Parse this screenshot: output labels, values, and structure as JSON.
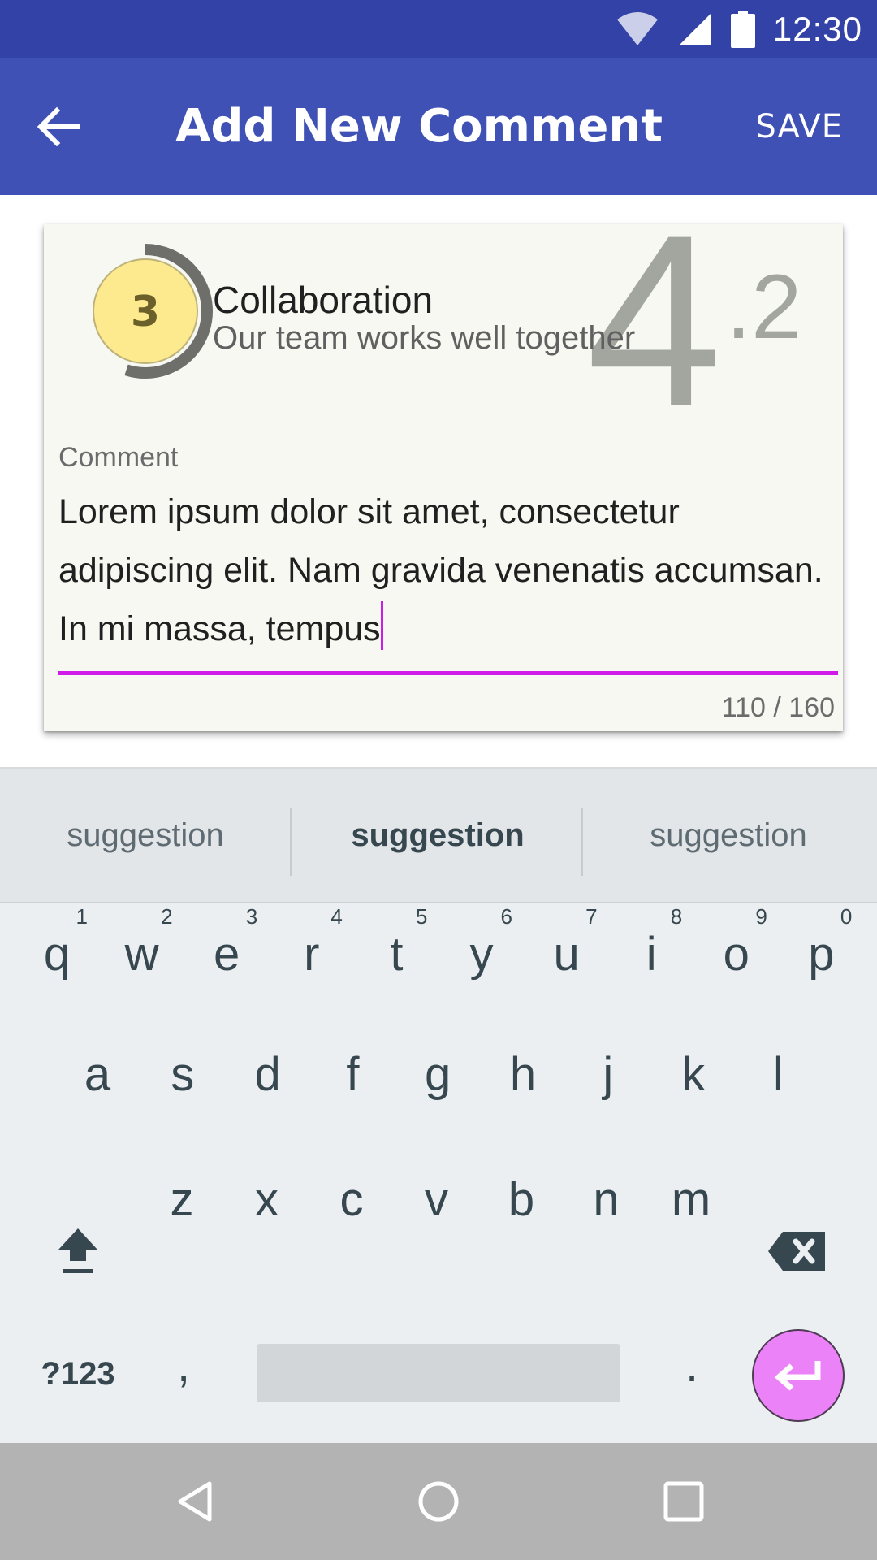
{
  "status_bar": {
    "time": "12:30",
    "icons": [
      "wifi-icon",
      "signal-icon",
      "battery-icon"
    ]
  },
  "app_bar": {
    "title": "Add New Comment",
    "save_label": "SAVE",
    "back_icon": "arrow-left-icon",
    "color": "#3f51b5"
  },
  "card": {
    "rank": "3",
    "ring_progress": 0.55,
    "topic_title": "Collaboration",
    "topic_subtitle": "Our team works well together",
    "score_integer": "4",
    "score_decimal": ".2",
    "comment_label": "Comment",
    "comment_text": "Lorem ipsum dolor sit amet, consectetur adipiscing elit. Nam gravida venenatis accumsan. In mi massa, tempus",
    "char_counter": "110 / 160",
    "accent": "#d11bea"
  },
  "keyboard": {
    "suggestions": [
      "suggestion",
      "suggestion",
      "suggestion"
    ],
    "row1": [
      {
        "k": "q",
        "n": "1"
      },
      {
        "k": "w",
        "n": "2"
      },
      {
        "k": "e",
        "n": "3"
      },
      {
        "k": "r",
        "n": "4"
      },
      {
        "k": "t",
        "n": "5"
      },
      {
        "k": "y",
        "n": "6"
      },
      {
        "k": "u",
        "n": "7"
      },
      {
        "k": "i",
        "n": "8"
      },
      {
        "k": "o",
        "n": "9"
      },
      {
        "k": "p",
        "n": "0"
      }
    ],
    "row2": [
      "a",
      "s",
      "d",
      "f",
      "g",
      "h",
      "j",
      "k",
      "l"
    ],
    "row3": [
      "z",
      "x",
      "c",
      "v",
      "b",
      "n",
      "m"
    ],
    "symbols_label": "?123",
    "comma": ",",
    "period": ".",
    "enter_color": "#ec82f8"
  },
  "nav_bar": {
    "icons": [
      "back-triangle-icon",
      "home-circle-icon",
      "recents-square-icon"
    ]
  }
}
